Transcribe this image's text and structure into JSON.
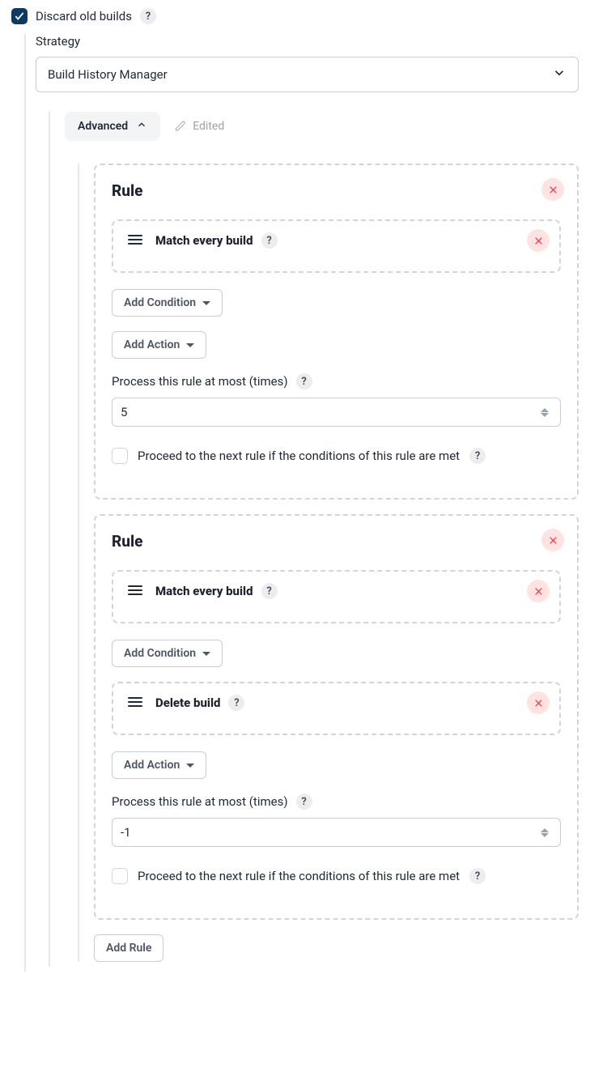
{
  "discard": {
    "label": "Discard old builds",
    "checked": true
  },
  "strategy": {
    "label": "Strategy",
    "selected": "Build History Manager"
  },
  "advanced": {
    "label": "Advanced",
    "edited": "Edited"
  },
  "rules": [
    {
      "title": "Rule",
      "conditions": [
        {
          "label": "Match every build"
        }
      ],
      "actions": [],
      "add_condition_label": "Add Condition",
      "add_action_label": "Add Action",
      "process_label": "Process this rule at most (times)",
      "process_value": "5",
      "proceed_label": "Proceed to the next rule if the conditions of this rule are met",
      "proceed_checked": false
    },
    {
      "title": "Rule",
      "conditions": [
        {
          "label": "Match every build"
        }
      ],
      "actions": [
        {
          "label": "Delete build"
        }
      ],
      "add_condition_label": "Add Condition",
      "add_action_label": "Add Action",
      "process_label": "Process this rule at most (times)",
      "process_value": "-1",
      "proceed_label": "Proceed to the next rule if the conditions of this rule are met",
      "proceed_checked": false
    }
  ],
  "add_rule_label": "Add Rule"
}
